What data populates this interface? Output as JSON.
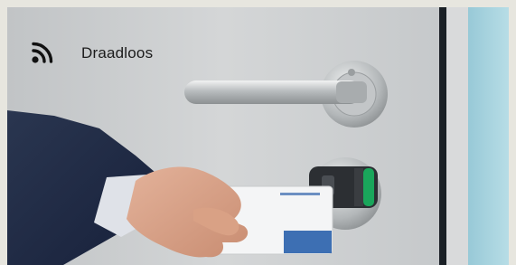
{
  "overlay": {
    "icon": "wireless-signal-icon",
    "label": "Draadloos"
  },
  "colors": {
    "frame": "#e7e6df",
    "door_panel": "#c9cbcc",
    "door_edge": "#1a2026",
    "wall_blue": "#a7d3df",
    "suit": "#1f2a3f",
    "skin": "#d8a58c",
    "card": "#f4f5f6",
    "card_stripe": "#3d6fb3",
    "lock_led": "#1aa65b"
  }
}
